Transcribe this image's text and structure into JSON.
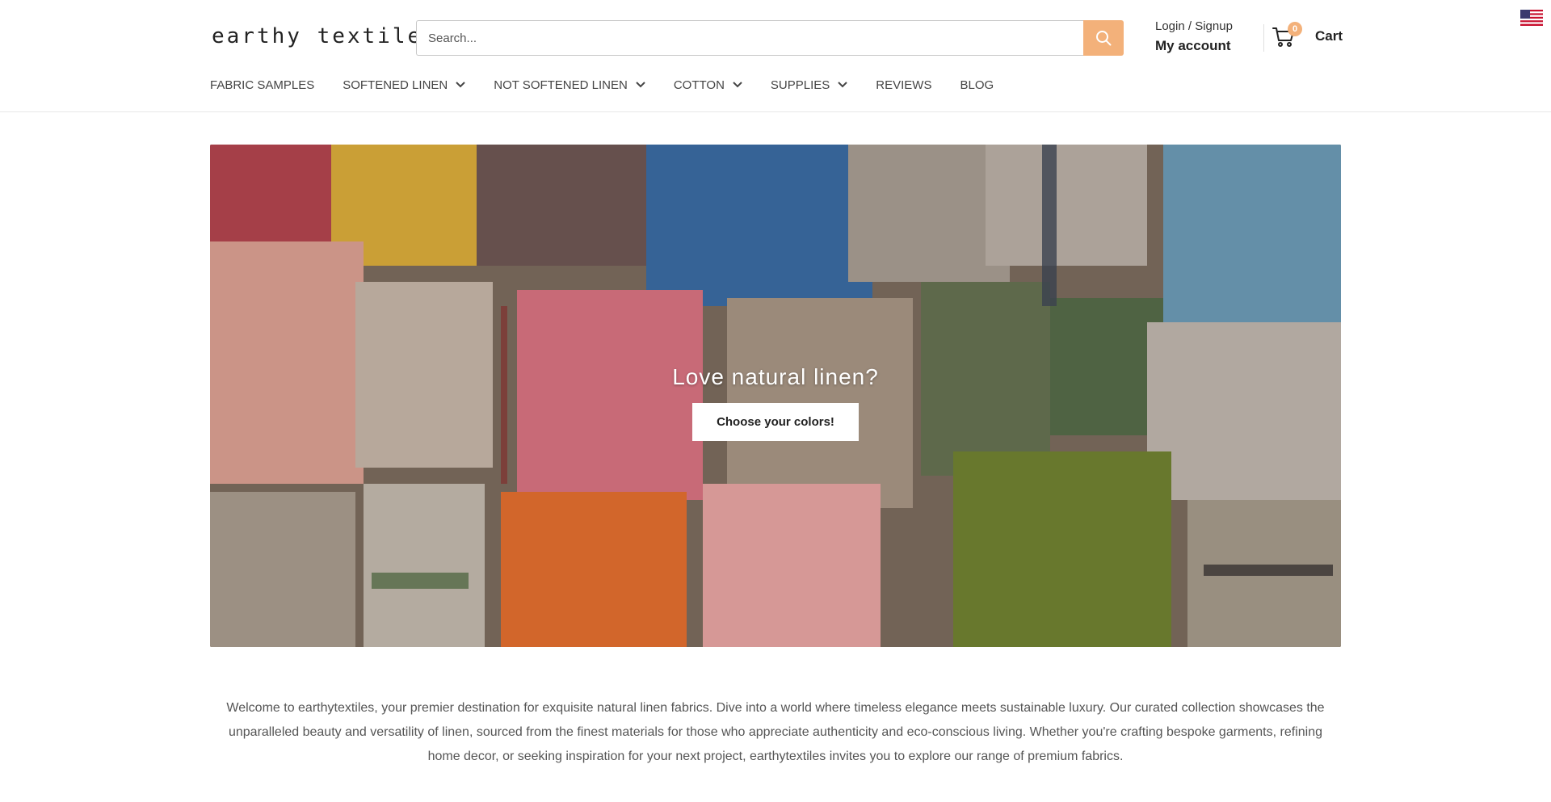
{
  "header": {
    "logo": "earthy textiles",
    "search": {
      "placeholder": "Search..."
    },
    "account": {
      "login_label": "Login / Signup",
      "account_label": "My account"
    },
    "cart": {
      "count": "0",
      "label": "Cart"
    },
    "flag": "us-flag-icon"
  },
  "nav": {
    "items": [
      {
        "label": "FABRIC SAMPLES",
        "dropdown": false
      },
      {
        "label": "SOFTENED LINEN",
        "dropdown": true
      },
      {
        "label": "NOT SOFTENED LINEN",
        "dropdown": true
      },
      {
        "label": "COTTON",
        "dropdown": true
      },
      {
        "label": "SUPPLIES",
        "dropdown": true
      },
      {
        "label": "REVIEWS",
        "dropdown": false
      },
      {
        "label": "BLOG",
        "dropdown": false
      }
    ]
  },
  "hero": {
    "title": "Love natural linen?",
    "button_label": "Choose your colors!"
  },
  "intro": {
    "text": "Welcome to earthytextiles, your premier destination for exquisite natural linen fabrics. Dive into a world where timeless elegance meets sustainable luxury. Our curated collection showcases the unparalleled beauty and versatility of linen, sourced from the finest materials for those who appreciate authenticity and eco-conscious living. Whether you're crafting bespoke garments, refining home decor, or seeking inspiration for your next project, earthytextiles invites you to explore our range of premium fabrics."
  },
  "colors": {
    "accent": "#f3b17a",
    "text": "#333333"
  }
}
